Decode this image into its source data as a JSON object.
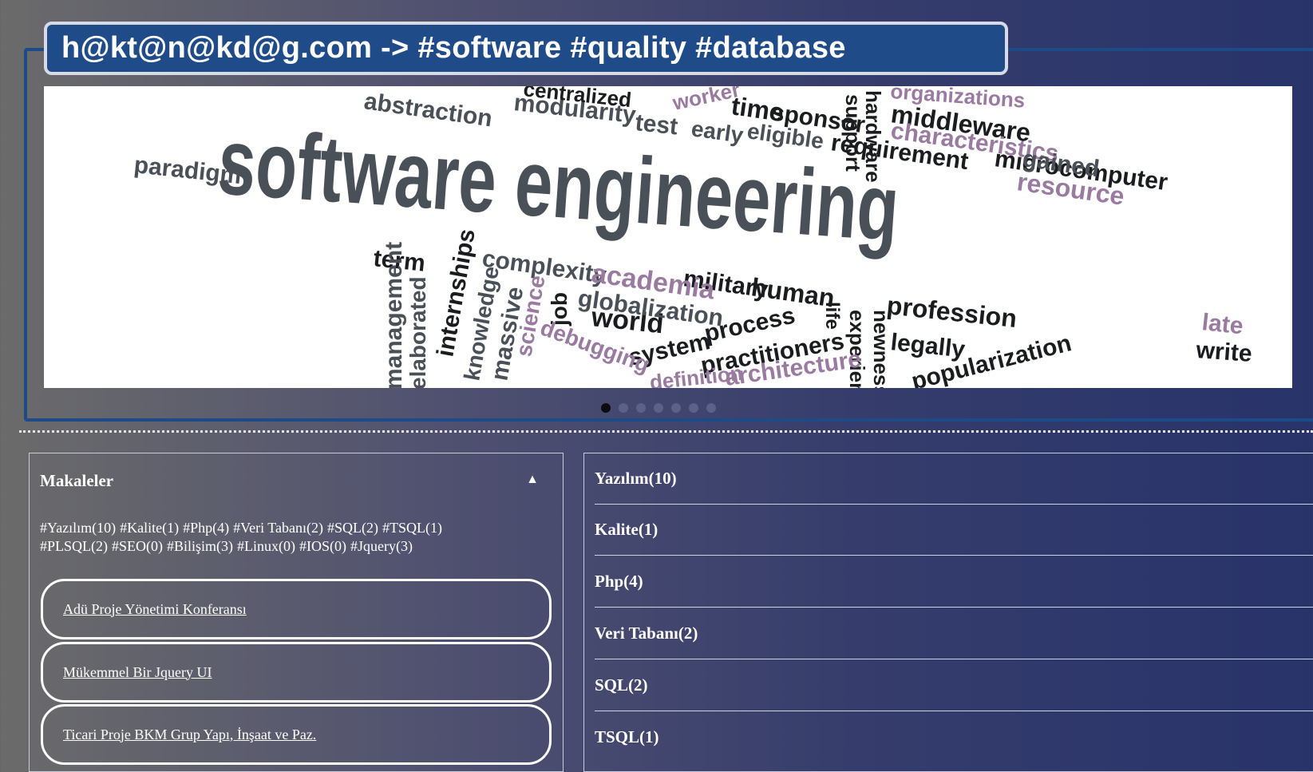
{
  "header": {
    "title": "h@kt@n@kd@g.com -> #software #quality #database"
  },
  "banner": {
    "words_dark": [
      "software engineering",
      "paradigm",
      "abstraction",
      "modularity",
      "test",
      "early",
      "eligible",
      "requirement",
      "microcomputer",
      "middleware",
      "time",
      "sponsor",
      "term",
      "complexity",
      "military",
      "human",
      "world",
      "system",
      "process",
      "practitioners",
      "profession",
      "legally",
      "write",
      "massive",
      "knowledge",
      "internships",
      "job",
      "globalization",
      "management",
      "elaborated",
      "support",
      "hardware",
      "newness",
      "experience",
      "life",
      "centralized"
    ],
    "words_purple": [
      "characteristics",
      "gained",
      "resource",
      "academia",
      "science",
      "debugging",
      "architecture",
      "late",
      "organizations",
      "worker",
      "definition",
      "popularization"
    ],
    "colors": {
      "dark": "#4a5058",
      "purple": "#9a7aa0"
    }
  },
  "carousel": {
    "count": 7,
    "active_index": 0
  },
  "left_panel": {
    "heading": "Makaleler",
    "toggle_icon": "▲",
    "tags": [
      "#Yazılım(10)",
      "#Kalite(1)",
      "#Php(4)",
      "#Veri Tabanı(2)",
      "#SQL(2)",
      "#TSQL(1)",
      "#PLSQL(2)",
      "#SEO(0)",
      "#Bilişim(3)",
      "#Linux(0)",
      "#IOS(0)",
      "#Jquery(3)"
    ],
    "articles": [
      "Adü Proje Yönetimi Konferansı",
      "Mükemmel Bir Jquery UI",
      "Ticari Proje BKM Grup Yapı, İnşaat ve Paz."
    ]
  },
  "right_panel": {
    "categories": [
      "Yazılım(10)",
      "Kalite(1)",
      "Php(4)",
      "Veri Tabanı(2)",
      "SQL(2)",
      "TSQL(1)"
    ]
  }
}
